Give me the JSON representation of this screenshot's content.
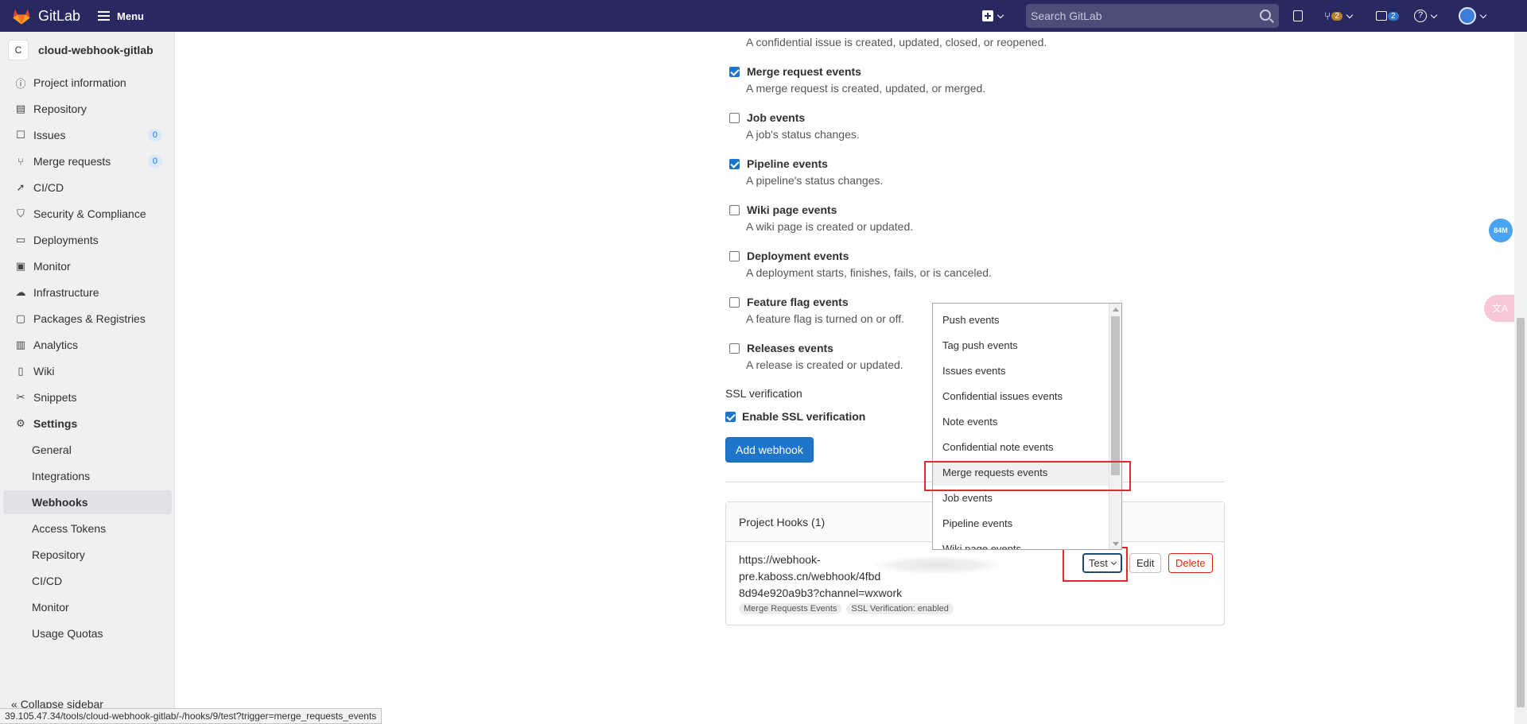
{
  "topbar": {
    "brand": "GitLab",
    "menu_label": "Menu",
    "search_placeholder": "Search GitLab",
    "merge_requests_count": "2",
    "todos_count": "2",
    "help_label": "?"
  },
  "sidebar": {
    "project_avatar": "C",
    "project_name": "cloud-webhook-gitlab",
    "items": [
      {
        "label": "Project information",
        "icon": "info-icon"
      },
      {
        "label": "Repository",
        "icon": "document-icon"
      },
      {
        "label": "Issues",
        "icon": "issues-icon",
        "count": "0"
      },
      {
        "label": "Merge requests",
        "icon": "merge-request-icon",
        "count": "0"
      },
      {
        "label": "CI/CD",
        "icon": "rocket-icon"
      },
      {
        "label": "Security & Compliance",
        "icon": "shield-icon"
      },
      {
        "label": "Deployments",
        "icon": "deployments-icon"
      },
      {
        "label": "Monitor",
        "icon": "monitor-icon"
      },
      {
        "label": "Infrastructure",
        "icon": "cloud-icon"
      },
      {
        "label": "Packages & Registries",
        "icon": "package-icon"
      },
      {
        "label": "Analytics",
        "icon": "chart-icon"
      },
      {
        "label": "Wiki",
        "icon": "book-icon"
      },
      {
        "label": "Snippets",
        "icon": "scissors-icon"
      },
      {
        "label": "Settings",
        "icon": "gear-icon"
      }
    ],
    "settings_sub": [
      {
        "label": "General"
      },
      {
        "label": "Integrations"
      },
      {
        "label": "Webhooks",
        "active": true
      },
      {
        "label": "Access Tokens"
      },
      {
        "label": "Repository"
      },
      {
        "label": "CI/CD"
      },
      {
        "label": "Monitor"
      },
      {
        "label": "Usage Quotas"
      }
    ],
    "collapse_label": "Collapse sidebar"
  },
  "events": {
    "top_desc": "A confidential issue is created, updated, closed, or reopened.",
    "items": [
      {
        "title": "Merge request events",
        "desc": "A merge request is created, updated, or merged.",
        "checked": true
      },
      {
        "title": "Job events",
        "desc": "A job's status changes.",
        "checked": false
      },
      {
        "title": "Pipeline events",
        "desc": "A pipeline's status changes.",
        "checked": true
      },
      {
        "title": "Wiki page events",
        "desc": "A wiki page is created or updated.",
        "checked": false
      },
      {
        "title": "Deployment events",
        "desc": "A deployment starts, finishes, fails, or is canceled.",
        "checked": false
      },
      {
        "title": "Feature flag events",
        "desc": "A feature flag is turned on or off.",
        "checked": false
      },
      {
        "title": "Releases events",
        "desc": "A release is created or updated.",
        "checked": false
      }
    ]
  },
  "ssl": {
    "section_label": "SSL verification",
    "checkbox_label": "Enable SSL verification",
    "checked": true
  },
  "add_webhook_label": "Add webhook",
  "hooks": {
    "header": "Project Hooks (1)",
    "url_line1": "https://webhook-",
    "url_line2": "pre.kaboss.cn/webhook/4fbd",
    "url_line3": "8d94e920a9b3?channel=wxwork",
    "badges": [
      "Merge Requests Events",
      "SSL Verification: enabled"
    ],
    "test_label": "Test",
    "edit_label": "Edit",
    "delete_label": "Delete"
  },
  "test_dropdown": {
    "options": [
      "Push events",
      "Tag push events",
      "Issues events",
      "Confidential issues events",
      "Note events",
      "Confidential note events",
      "Merge requests events",
      "Job events",
      "Pipeline events",
      "Wiki page events"
    ],
    "highlighted": "Merge requests events"
  },
  "widgets": {
    "memory_badge": "84M",
    "translate_icon": "translate-icon"
  },
  "statusbar_url": "39.105.47.34/tools/cloud-webhook-gitlab/-/hooks/9/test?trigger=merge_requests_events",
  "colors": {
    "navbar": "#292961",
    "primary": "#1f75cb",
    "danger": "#dd2b0e",
    "highlight_box": "#e5272e"
  }
}
